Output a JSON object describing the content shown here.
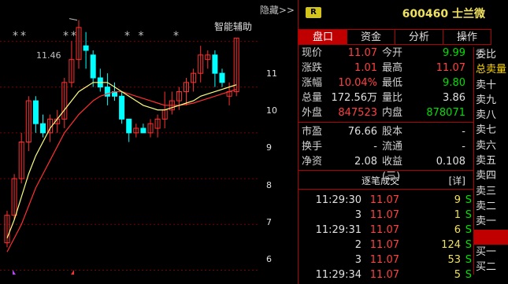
{
  "chart": {
    "hide_label": "隐藏>>",
    "assist_label": "智能辅助",
    "high_label": "11.46",
    "stars": [
      "**",
      "**",
      "* *",
      "*"
    ],
    "y_ticks": [
      "11",
      "10",
      "9",
      "8",
      "7",
      "6"
    ],
    "colors": {
      "up": "#ff3030",
      "down": "#00ffff",
      "ma_fast": "#ffff80",
      "ma_slow": "#ff3030",
      "grid": "#7a0000"
    }
  },
  "chart_data": {
    "type": "candlestick",
    "ylim": [
      5.7,
      11.9
    ],
    "candles": [
      {
        "o": 6.6,
        "h": 7.3,
        "l": 6.5,
        "c": 7.2
      },
      {
        "o": 7.2,
        "h": 8.1,
        "l": 7.1,
        "c": 8.0
      },
      {
        "o": 8.0,
        "h": 9.0,
        "l": 7.9,
        "c": 8.8
      },
      {
        "o": 8.8,
        "h": 9.8,
        "l": 8.6,
        "c": 9.7
      },
      {
        "o": 9.7,
        "h": 9.8,
        "l": 9.0,
        "c": 9.2
      },
      {
        "o": 9.2,
        "h": 9.4,
        "l": 8.9,
        "c": 9.0
      },
      {
        "o": 9.0,
        "h": 9.4,
        "l": 8.8,
        "c": 9.3
      },
      {
        "o": 9.2,
        "h": 9.5,
        "l": 9.0,
        "c": 9.3
      },
      {
        "o": 9.3,
        "h": 10.2,
        "l": 9.1,
        "c": 10.1
      },
      {
        "o": 10.1,
        "h": 11.0,
        "l": 10.0,
        "c": 10.6
      },
      {
        "o": 10.6,
        "h": 11.46,
        "l": 10.4,
        "c": 11.3
      },
      {
        "o": 10.9,
        "h": 11.2,
        "l": 10.4,
        "c": 10.8
      },
      {
        "o": 10.7,
        "h": 10.8,
        "l": 10.0,
        "c": 10.2
      },
      {
        "o": 10.2,
        "h": 10.4,
        "l": 9.9,
        "c": 10.0
      },
      {
        "o": 10.0,
        "h": 10.3,
        "l": 9.6,
        "c": 9.8
      },
      {
        "o": 9.9,
        "h": 10.1,
        "l": 9.7,
        "c": 9.8
      },
      {
        "o": 9.8,
        "h": 9.9,
        "l": 9.2,
        "c": 9.3
      },
      {
        "o": 9.3,
        "h": 9.3,
        "l": 8.8,
        "c": 9.0
      },
      {
        "o": 9.0,
        "h": 9.2,
        "l": 8.9,
        "c": 9.1
      },
      {
        "o": 9.1,
        "h": 9.2,
        "l": 9.0,
        "c": 9.0
      },
      {
        "o": 9.0,
        "h": 9.3,
        "l": 8.9,
        "c": 9.2
      },
      {
        "o": 9.1,
        "h": 9.4,
        "l": 8.9,
        "c": 9.3
      },
      {
        "o": 9.3,
        "h": 9.9,
        "l": 9.1,
        "c": 9.5
      },
      {
        "o": 9.5,
        "h": 9.9,
        "l": 9.4,
        "c": 9.7
      },
      {
        "o": 9.7,
        "h": 10.0,
        "l": 9.5,
        "c": 9.9
      },
      {
        "o": 9.9,
        "h": 10.2,
        "l": 9.6,
        "c": 10.1
      },
      {
        "o": 10.1,
        "h": 10.4,
        "l": 9.9,
        "c": 10.3
      },
      {
        "o": 10.3,
        "h": 10.9,
        "l": 10.1,
        "c": 10.7
      },
      {
        "o": 10.6,
        "h": 10.8,
        "l": 10.4,
        "c": 10.7
      },
      {
        "o": 10.7,
        "h": 10.8,
        "l": 10.0,
        "c": 10.3
      },
      {
        "o": 10.3,
        "h": 10.4,
        "l": 10.0,
        "c": 10.1
      },
      {
        "o": 9.8,
        "h": 10.1,
        "l": 9.6,
        "c": 9.9
      },
      {
        "o": 9.9,
        "h": 11.07,
        "l": 9.8,
        "c": 11.07
      }
    ],
    "ma_fast": [
      6.7,
      7.1,
      7.6,
      8.1,
      8.5,
      8.8,
      9.1,
      9.3,
      9.5,
      9.7,
      9.9,
      10.0,
      10.1,
      10.1,
      10.1,
      10.0,
      9.9,
      9.8,
      9.7,
      9.6,
      9.55,
      9.5,
      9.5,
      9.55,
      9.6,
      9.65,
      9.7,
      9.8,
      9.85,
      9.9,
      9.95,
      10.0,
      10.05
    ],
    "ma_slow": [
      6.4,
      6.7,
      7.0,
      7.4,
      7.8,
      8.1,
      8.4,
      8.7,
      9.0,
      9.2,
      9.4,
      9.55,
      9.7,
      9.8,
      9.85,
      9.9,
      9.9,
      9.85,
      9.8,
      9.75,
      9.7,
      9.65,
      9.6,
      9.6,
      9.6,
      9.62,
      9.65,
      9.7,
      9.75,
      9.8,
      9.85,
      9.9,
      9.95
    ]
  },
  "panel": {
    "badge": "R",
    "stock_code": "600460",
    "stock_name": "士兰微",
    "tabs": [
      "盘口",
      "资金",
      "分析",
      "操作"
    ],
    "quote": [
      {
        "l1": "现价",
        "v1": "11.07",
        "c1": "red",
        "l2": "今开",
        "v2": "9.99",
        "c2": "green"
      },
      {
        "l1": "涨跌",
        "v1": "1.01",
        "c1": "red",
        "l2": "最高",
        "v2": "11.07",
        "c2": "red"
      },
      {
        "l1": "涨幅",
        "v1": "10.04%",
        "c1": "red",
        "l2": "最低",
        "v2": "9.80",
        "c2": "green"
      },
      {
        "l1": "总量",
        "v1": "172.56万",
        "c1": "white",
        "l2": "量比",
        "v2": "3.86",
        "c2": "white"
      },
      {
        "l1": "外盘",
        "v1": "847523",
        "c1": "red",
        "l2": "内盘",
        "v2": "878071",
        "c2": "green"
      }
    ],
    "fin": [
      {
        "l1": "市盈",
        "v1": "76.66",
        "l2": "股本",
        "v2": "-"
      },
      {
        "l1": "换手",
        "v1": "-",
        "l2": "流通",
        "v2": "-"
      },
      {
        "l1": "净资",
        "v1": "2.08",
        "l2": "收益(三)",
        "v2": "0.108"
      }
    ],
    "trades_title": "逐笔成交",
    "trades_btn": "[详]",
    "trades": [
      {
        "time": "11:29:30",
        "price": "11.07",
        "vol": "9",
        "side": "S"
      },
      {
        "time": "3",
        "price": "11.07",
        "vol": "1",
        "side": "S"
      },
      {
        "time": "11:29:31",
        "price": "11.07",
        "vol": "6",
        "side": "S"
      },
      {
        "time": "2",
        "price": "11.07",
        "vol": "124",
        "side": "S"
      },
      {
        "time": "3",
        "price": "11.07",
        "vol": "53",
        "side": "S"
      },
      {
        "time": "11:29:34",
        "price": "11.07",
        "vol": "5",
        "side": "S"
      }
    ],
    "side_list": [
      "委比",
      "总卖量",
      "卖十",
      "卖九",
      "卖八",
      "卖七",
      "卖六",
      "卖五",
      "卖四",
      "卖三",
      "卖二",
      "卖一",
      "",
      "买一",
      "买二"
    ]
  }
}
